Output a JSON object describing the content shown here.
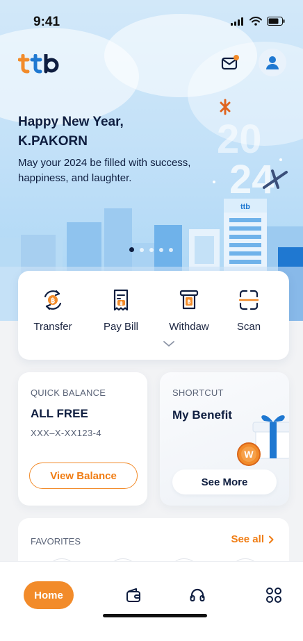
{
  "status_bar": {
    "time": "9:41"
  },
  "header": {
    "brand": "ttb",
    "logo_alt": "ttb-logo"
  },
  "banner": {
    "greeting": "Happy New Year,",
    "name": "K.PAKORN",
    "message": "May your 2024 be filled with success, happiness, and laughter.",
    "year_top": "20",
    "year_bottom": "24",
    "building_brand": "ttb",
    "slides_total": 5,
    "slide_active": 1
  },
  "quick_actions": [
    {
      "label": "Transfer",
      "icon": "transfer-icon"
    },
    {
      "label": "Pay Bill",
      "icon": "bill-icon"
    },
    {
      "label": "Withdaw",
      "icon": "withdraw-icon"
    },
    {
      "label": "Scan",
      "icon": "scan-icon"
    }
  ],
  "quick_balance": {
    "caption": "QUICK BALANCE",
    "title": "ALL FREE",
    "account": "XXX–X-XX123-4",
    "button_label": "View Balance"
  },
  "shortcut": {
    "caption": "SHORTCUT",
    "title": "My Benefit",
    "coin_label": "W",
    "button_label": "See More"
  },
  "favorites": {
    "caption": "FAVORITES",
    "see_all_label": "See all"
  },
  "bottom_nav": {
    "home_label": "Home",
    "items": [
      "wallet-icon",
      "support-icon",
      "menu-grid-icon"
    ]
  },
  "colors": {
    "accent": "#f28b2a",
    "brand_navy": "#0e1d3f",
    "brand_blue": "#1f78d1",
    "sky": "#c3e1f8"
  }
}
